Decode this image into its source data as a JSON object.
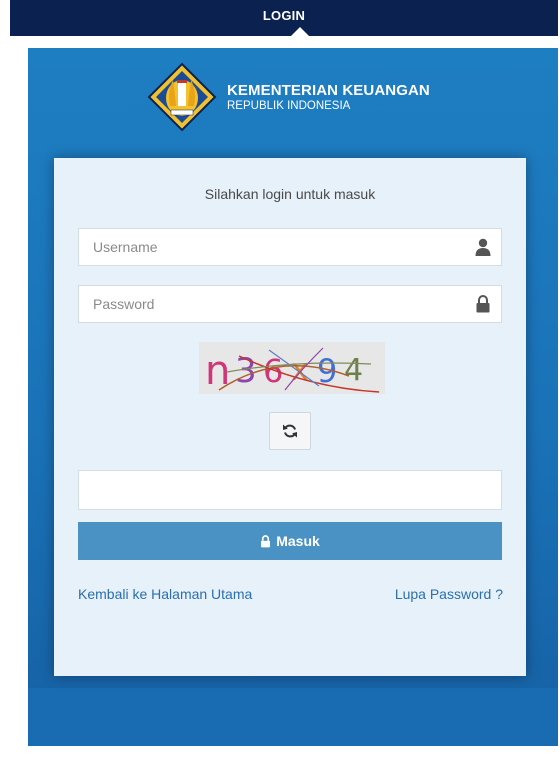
{
  "topbar": {
    "title": "LOGIN"
  },
  "brand": {
    "title": "KEMENTERIAN KEUANGAN",
    "subtitle": "REPUBLIK INDONESIA"
  },
  "form": {
    "welcome": "Silahkan login untuk masuk",
    "username_placeholder": "Username",
    "password_placeholder": "Password",
    "captcha_text": "n36x94",
    "captcha_answer": "",
    "submit_label": "Masuk",
    "back_link": "Kembali ke Halaman Utama",
    "forgot_link": "Lupa Password ?"
  },
  "icons": {
    "username": "user-icon",
    "password": "lock-icon",
    "refresh": "refresh-icon",
    "submit": "lock-icon"
  },
  "colors": {
    "topbar": "#0b2250",
    "panel": "#1a72b7",
    "card": "#e6f1f9",
    "button": "#4a92c4",
    "link": "#2a6fae"
  }
}
